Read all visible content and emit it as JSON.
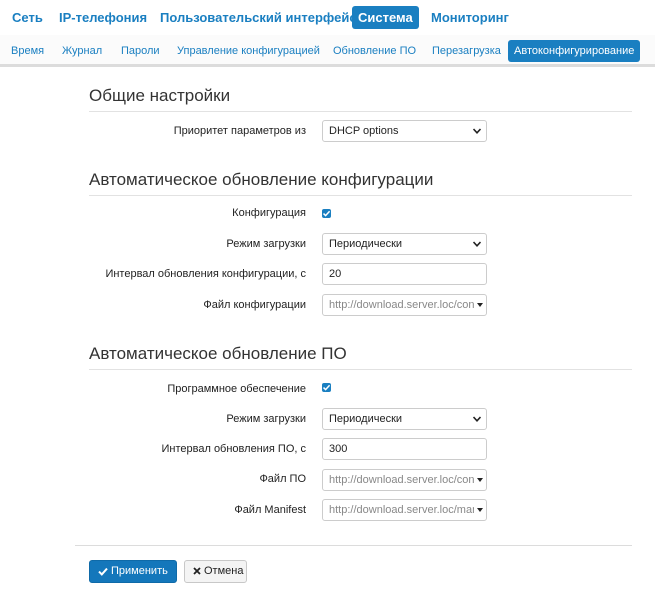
{
  "topnav": {
    "items": [
      {
        "label": "Сеть",
        "active": false
      },
      {
        "label": "IP-телефония",
        "active": false
      },
      {
        "label": "Пользовательский интерфейс",
        "active": false
      },
      {
        "label": "Система",
        "active": true
      },
      {
        "label": "Мониторинг",
        "active": false
      }
    ]
  },
  "subnav": {
    "items": [
      {
        "label": "Время",
        "active": false
      },
      {
        "label": "Журнал",
        "active": false
      },
      {
        "label": "Пароли",
        "active": false
      },
      {
        "label": "Управление конфигурацией",
        "active": false
      },
      {
        "label": "Обновление ПО",
        "active": false
      },
      {
        "label": "Перезагрузка",
        "active": false
      },
      {
        "label": "Автоконфигурирование",
        "active": true
      }
    ]
  },
  "general": {
    "title": "Общие настройки",
    "priority_label": "Приоритет параметров из",
    "priority_value": "DHCP options"
  },
  "config_update": {
    "title": "Автоматическое обновление конфигурации",
    "config_label": "Конфигурация",
    "config_checked": true,
    "mode_label": "Режим загрузки",
    "mode_value": "Периодически",
    "interval_label": "Интервал обновления конфигурации, с",
    "interval_value": "20",
    "file_label": "Файл конфигурации",
    "file_value": "http://download.server.loc/confi"
  },
  "fw_update": {
    "title": "Автоматическое обновление ПО",
    "software_label": "Программное обеспечение",
    "software_checked": true,
    "mode_label": "Режим загрузки",
    "mode_value": "Периодически",
    "interval_label": "Интервал обновления ПО, с",
    "interval_value": "300",
    "file_label": "Файл ПО",
    "file_value": "http://download.server.loc/confi",
    "manifest_label": "Файл Manifest",
    "manifest_value": "http://download.server.loc/mani"
  },
  "actions": {
    "apply_label": "Применить",
    "cancel_label": "Отмена"
  },
  "colors": {
    "accent": "#1a7fc1",
    "primary_button": "#1477bb"
  }
}
